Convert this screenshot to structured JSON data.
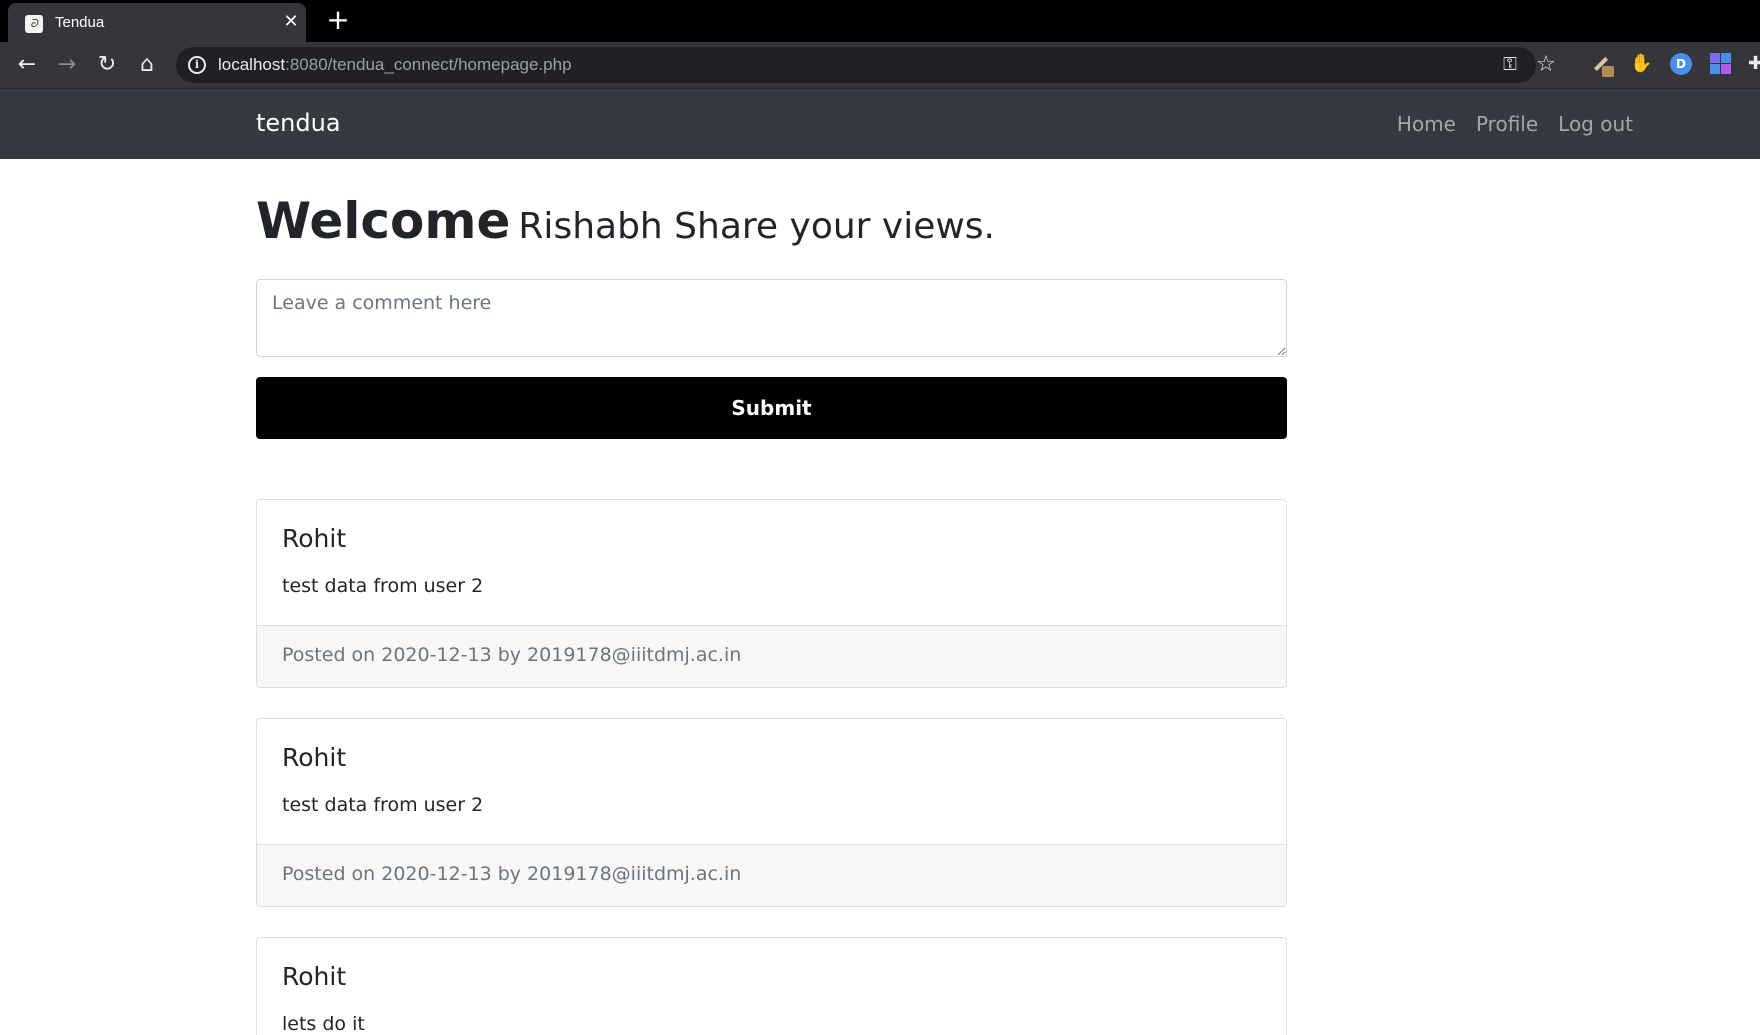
{
  "browser": {
    "tab_title": "Tendua",
    "new_tab_label": "+",
    "url_host": "localhost",
    "url_path": ":8080/tendua_connect/homepage.php"
  },
  "navbar": {
    "brand": "tendua",
    "links": [
      {
        "label": "Home"
      },
      {
        "label": "Profile"
      },
      {
        "label": "Log out"
      }
    ]
  },
  "welcome": {
    "heading": "Welcome",
    "subheading": "Rishabh Share your views."
  },
  "comment_form": {
    "placeholder": "Leave a comment here",
    "value": "",
    "submit_label": "Submit"
  },
  "posts": [
    {
      "author": "Rohit",
      "text": "test data from user 2",
      "footer": "Posted on 2020-12-13 by 2019178@iiitdmj.ac.in"
    },
    {
      "author": "Rohit",
      "text": "test data from user 2",
      "footer": "Posted on 2020-12-13 by 2019178@iiitdmj.ac.in"
    },
    {
      "author": "Rohit",
      "text": "lets do it",
      "footer": ""
    }
  ],
  "colors": {
    "navbar_bg": "#343a40",
    "submit_bg": "#000000",
    "card_footer_bg": "#f7f7f7"
  }
}
